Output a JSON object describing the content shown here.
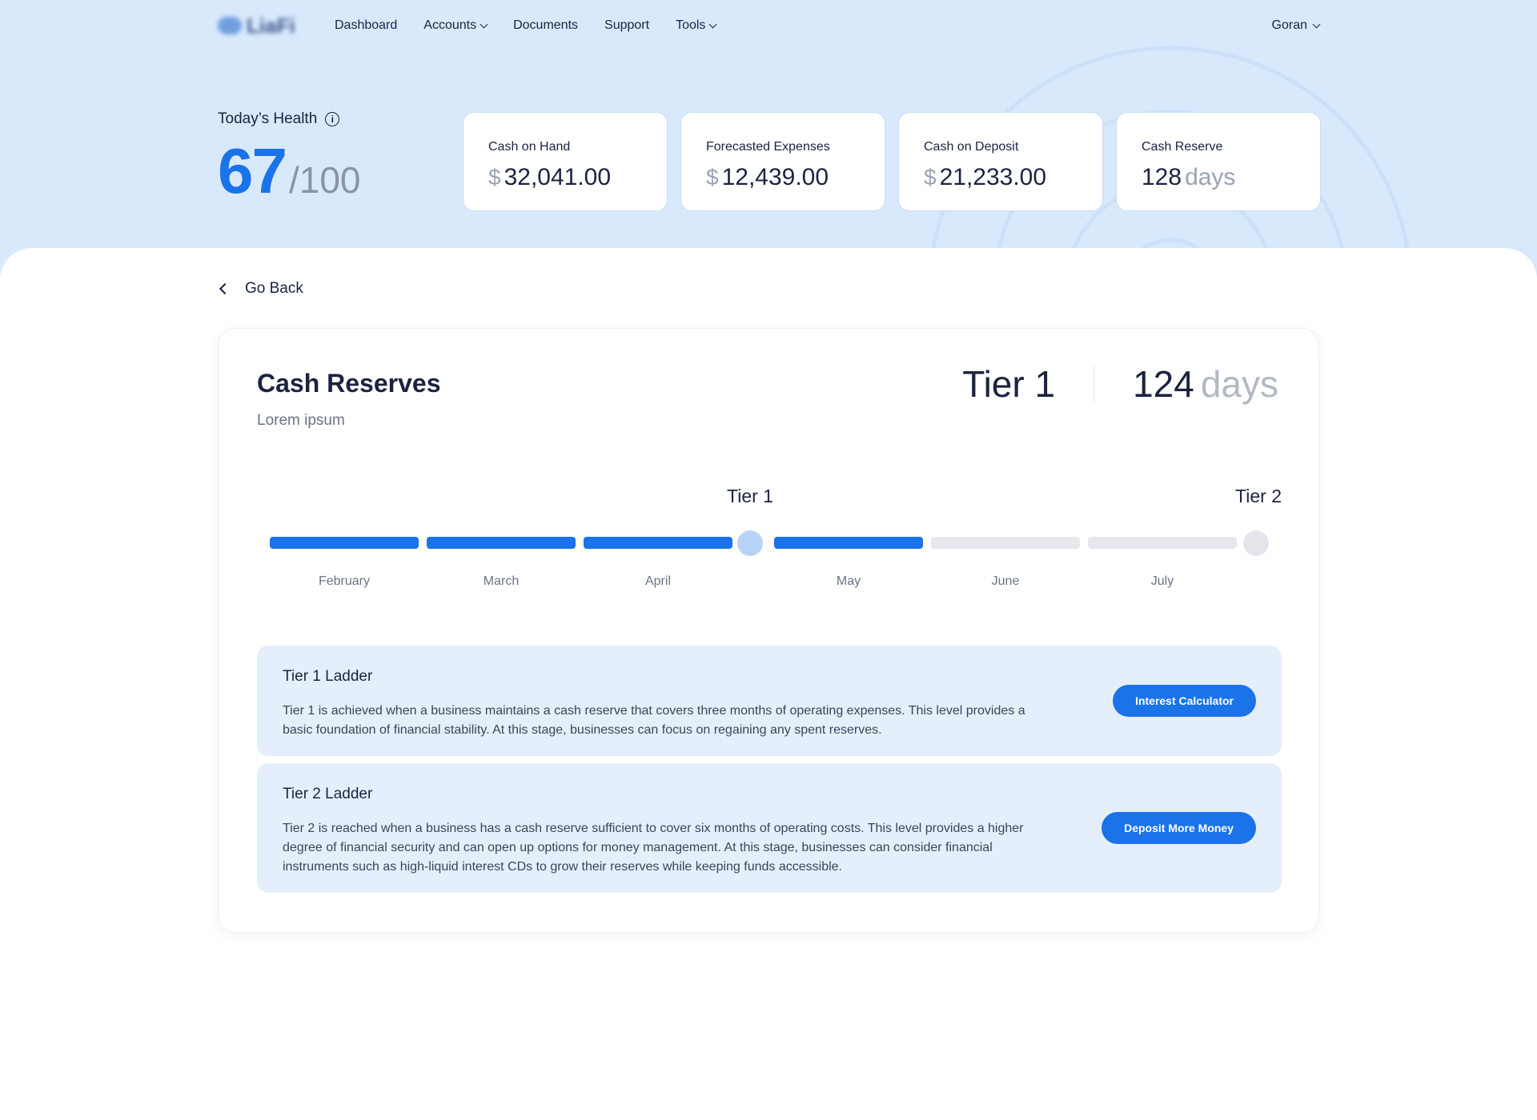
{
  "nav": {
    "logo_text": "LiaFi",
    "links": [
      "Dashboard",
      "Accounts",
      "Documents",
      "Support",
      "Tools"
    ],
    "user": "Goran"
  },
  "health": {
    "title": "Today’s Health",
    "score": "67",
    "max": "/100"
  },
  "stats": [
    {
      "label": "Cash on Hand",
      "currency": "$",
      "value": "32,041.00"
    },
    {
      "label": "Forecasted Expenses",
      "currency": "$",
      "value": "12,439.00"
    },
    {
      "label": "Cash on Deposit",
      "currency": "$",
      "value": "21,233.00"
    },
    {
      "label": "Cash Reserve",
      "value": "128",
      "unit": "days"
    }
  ],
  "back_label": "Go Back",
  "panel": {
    "title": "Cash Reserves",
    "subtitle": "Lorem ipsum",
    "tier": "Tier 1",
    "days": "124",
    "days_unit": "days"
  },
  "progress": {
    "milestones": [
      "Tier 1",
      "Tier 2"
    ],
    "months": [
      "February",
      "March",
      "April",
      "May",
      "June",
      "July"
    ],
    "completed_months": 4,
    "tiers_reached": 1
  },
  "ladders": [
    {
      "title": "Tier 1 Ladder",
      "text": "Tier 1 is achieved when a business maintains a cash reserve that covers three months of operating expenses. This level provides a basic foundation of financial stability. At this stage, businesses can focus on regaining any spent reserves.",
      "button": "Interest Calculator"
    },
    {
      "title": "Tier 2 Ladder",
      "text": "Tier 2 is reached when a business has a cash reserve sufficient to cover six months of operating costs. This level provides a higher degree of financial security and can open up options for money management. At this stage, businesses can consider financial instruments such as high-liquid interest CDs to grow their reserves while keeping funds accessible.",
      "button": "Deposit More Money"
    }
  ],
  "colors": {
    "accent": "#1a73e8",
    "hero_bg": "#d9e9fc",
    "ladder_bg": "#e5effc"
  }
}
